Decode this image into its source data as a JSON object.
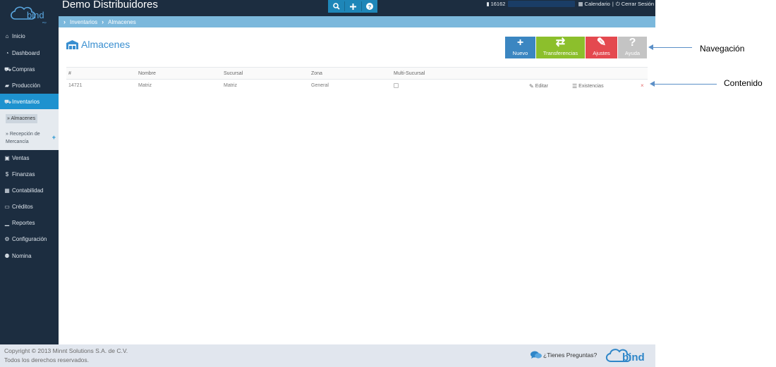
{
  "app": {
    "title": "Demo Distribuidores"
  },
  "logo": {
    "text": "bind",
    "sub": "erp"
  },
  "topbar": {
    "search_icon": "search-icon",
    "plus_icon": "plus-icon",
    "help_icon": "question-icon",
    "user_id": "16162",
    "calendar": "Calendario",
    "separator": "|",
    "logout": "Cerrar Sesión"
  },
  "breadcrumb": {
    "items": [
      "Inventarios",
      "Almacenes"
    ]
  },
  "sidebar": {
    "items": [
      {
        "label": "Inicio",
        "icon": "home-icon",
        "glyph": "⌂"
      },
      {
        "label": "Dashboard",
        "icon": "dashboard-icon",
        "glyph": "◔"
      },
      {
        "label": "Compras",
        "icon": "cart-icon",
        "glyph": "⛟"
      },
      {
        "label": "Producción",
        "icon": "factory-icon",
        "glyph": "▰"
      },
      {
        "label": "Inventarios",
        "icon": "warehouse-icon",
        "glyph": "⛟"
      },
      {
        "label": "Ventas",
        "icon": "shopping-bag-icon",
        "glyph": "▣"
      },
      {
        "label": "Finanzas",
        "icon": "dollar-icon",
        "glyph": "$"
      },
      {
        "label": "Contabilidad",
        "icon": "calculator-icon",
        "glyph": "▦"
      },
      {
        "label": "Créditos",
        "icon": "credit-card-icon",
        "glyph": "▭"
      },
      {
        "label": "Reportes",
        "icon": "bar-chart-icon",
        "glyph": "▁"
      },
      {
        "label": "Configuración",
        "icon": "cogs-icon",
        "glyph": "⚙"
      },
      {
        "label": "Nomina",
        "icon": "users-icon",
        "glyph": "⚉"
      }
    ],
    "submenu": {
      "items": [
        "» Almacenes",
        "» Recepción de",
        "Mercancía"
      ],
      "plus": "+"
    }
  },
  "page": {
    "title": "Almacenes",
    "icon": "warehouse-icon"
  },
  "actions": [
    {
      "label": "Nuevo",
      "glyph": "+",
      "color": "#3b86c1",
      "icon": "plus-icon"
    },
    {
      "label": "Transferencias",
      "glyph": "⇄",
      "color": "#8cbf2c",
      "icon": "exchange-icon"
    },
    {
      "label": "Ajustes",
      "glyph": "✎",
      "color": "#e4494f",
      "icon": "wrench-icon"
    },
    {
      "label": "Ayuda",
      "glyph": "?",
      "color": "#c4c4c4",
      "icon": "question-icon"
    }
  ],
  "table": {
    "headers": [
      "#",
      "Nombre",
      "Sucursal",
      "Zona",
      "Multi-Sucursal"
    ],
    "rows": [
      {
        "id": "14721",
        "nombre": "Matriz",
        "sucursal": "Matriz",
        "zona": "General",
        "multi": false,
        "edit": "Editar",
        "stock": "Existencias",
        "delete": "×"
      }
    ]
  },
  "annotations": {
    "nav": "Navegación",
    "content": "Contenido"
  },
  "footer": {
    "copyright": "Copyright © 2013 Minnt Solutions S.A. de C.V.",
    "rights": "Todos los derechos reservados.",
    "faq": "¿Tienes Preguntas?"
  }
}
